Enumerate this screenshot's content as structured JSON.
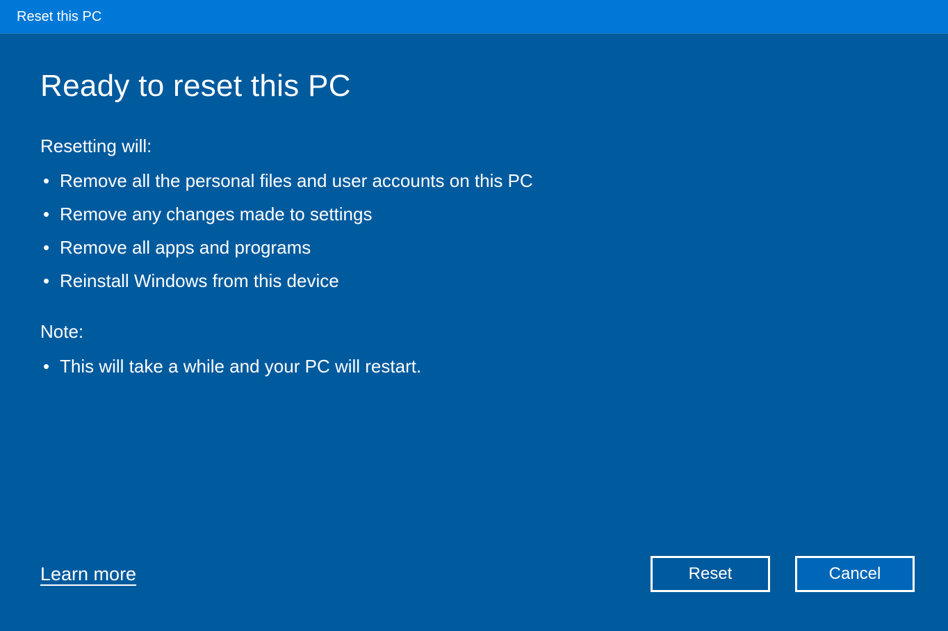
{
  "titlebar": {
    "title": "Reset this PC"
  },
  "main": {
    "heading": "Ready to reset this PC",
    "resetting_label": "Resetting will:",
    "resetting_items": [
      "Remove all the personal files and user accounts on this PC",
      "Remove any changes made to settings",
      "Remove all apps and programs",
      "Reinstall Windows from this device"
    ],
    "note_label": "Note:",
    "note_items": [
      "This will take a while and your PC will restart."
    ]
  },
  "footer": {
    "learn_more": "Learn more",
    "reset_label": "Reset",
    "cancel_label": "Cancel"
  }
}
